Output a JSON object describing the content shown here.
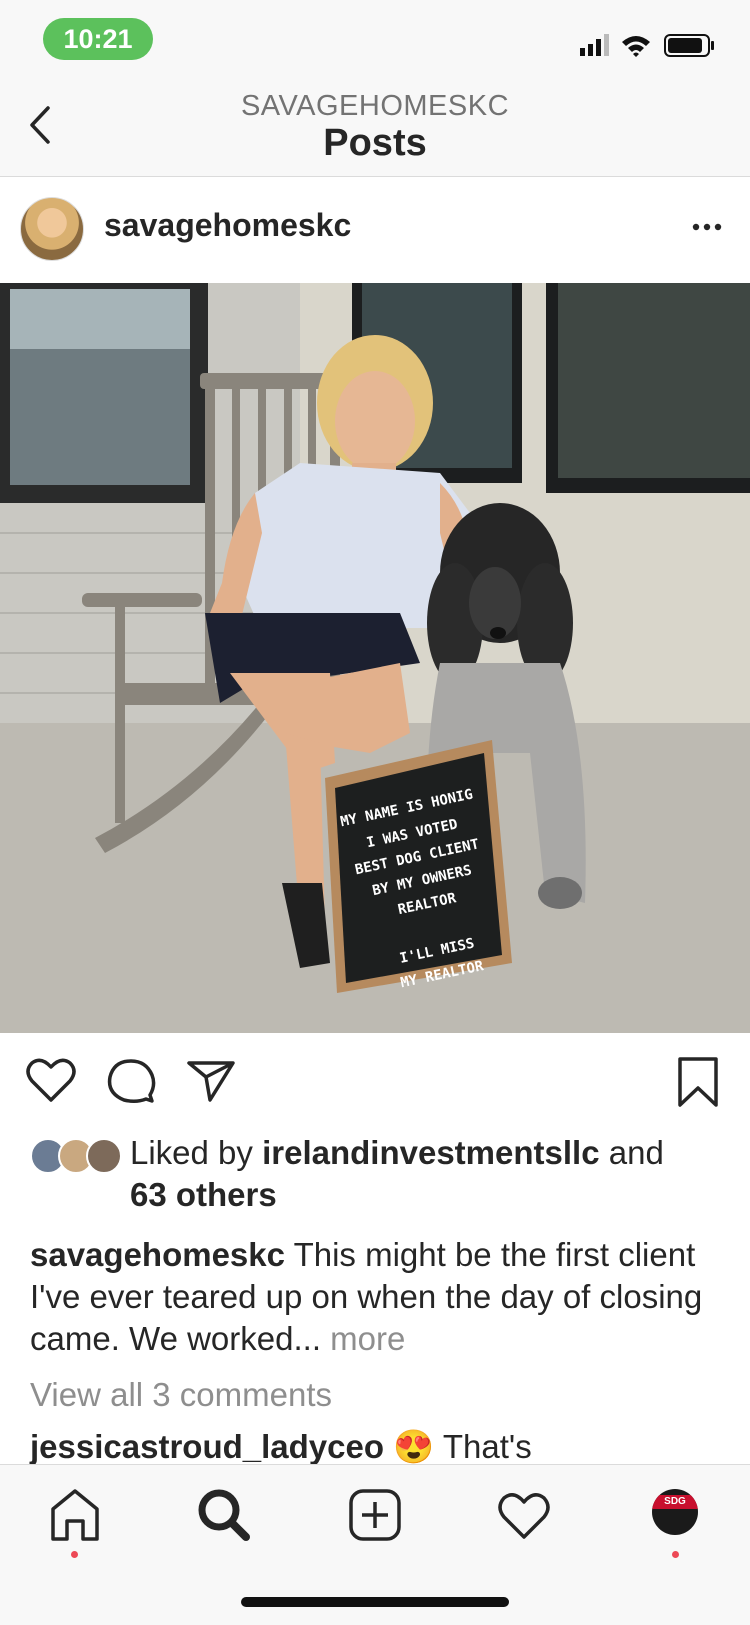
{
  "status": {
    "time": "10:21"
  },
  "header": {
    "subtitle": "SAVAGEHOMESKC",
    "title": "Posts"
  },
  "post": {
    "username": "savagehomeskc",
    "letterboard": [
      "MY NAME IS HONIG",
      "I WAS VOTED",
      "BEST DOG CLIENT",
      "BY MY OWNERS",
      "REALTOR",
      "",
      "I'LL MISS",
      "MY REALTOR"
    ],
    "likes": {
      "prefix": "Liked by",
      "user": "irelandinvestmentsllc",
      "and": "and",
      "others": "63 others"
    },
    "caption": {
      "user": "savagehomeskc",
      "text": "This might be the first client I've ever teared up on when the day of closing came. We worked...",
      "more": "more"
    },
    "view_all": "View all 3 comments",
    "comment": {
      "user": "jessicastroud_ladyceo",
      "emoji": "😍",
      "text": "That's"
    }
  },
  "tabbar": {
    "profile_badge": "SDG"
  },
  "colors": {
    "accent": "#ed4956",
    "time_pill": "#5cc15c",
    "muted": "#8e8e8e"
  },
  "icons": [
    "back-icon",
    "more-icon",
    "heart-icon",
    "comment-icon",
    "share-icon",
    "bookmark-icon",
    "home-icon",
    "search-icon",
    "add-icon",
    "activity-icon"
  ]
}
